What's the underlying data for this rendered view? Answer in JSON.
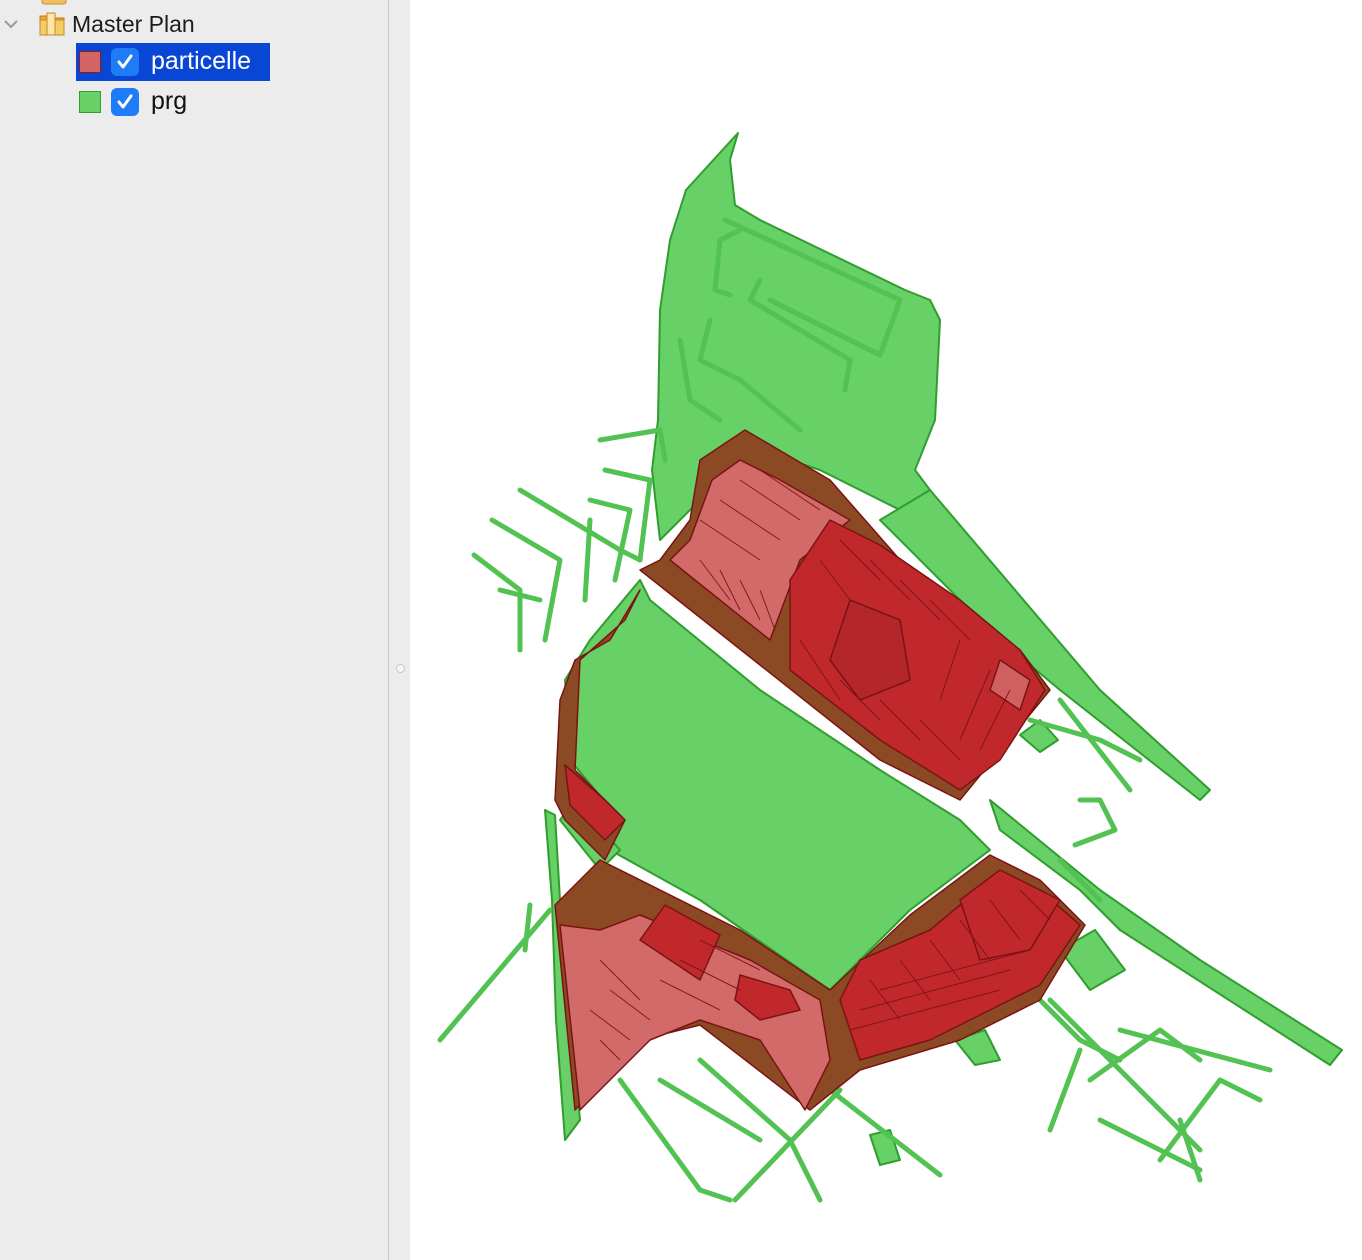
{
  "layers_panel": {
    "groups": [
      {
        "name": "Master Plan",
        "expanded": true
      }
    ],
    "layers": [
      {
        "name": "particelle",
        "visible": true,
        "selected": true,
        "fill_color": "#d36464",
        "stroke_color": "#8b1d1d"
      },
      {
        "name": "prg",
        "visible": true,
        "selected": false,
        "fill_color": "#67d067",
        "stroke_color": "#2ea02e"
      }
    ]
  },
  "map": {
    "background": "#ffffff",
    "prg_fill": "#67d067",
    "prg_stroke": "#2f9e2f",
    "particelle_fill_light": "#d26a6a",
    "particelle_fill_dark": "#c0282c",
    "particelle_stroke": "#7a1414",
    "particelle_brown": "#8c4a24"
  }
}
